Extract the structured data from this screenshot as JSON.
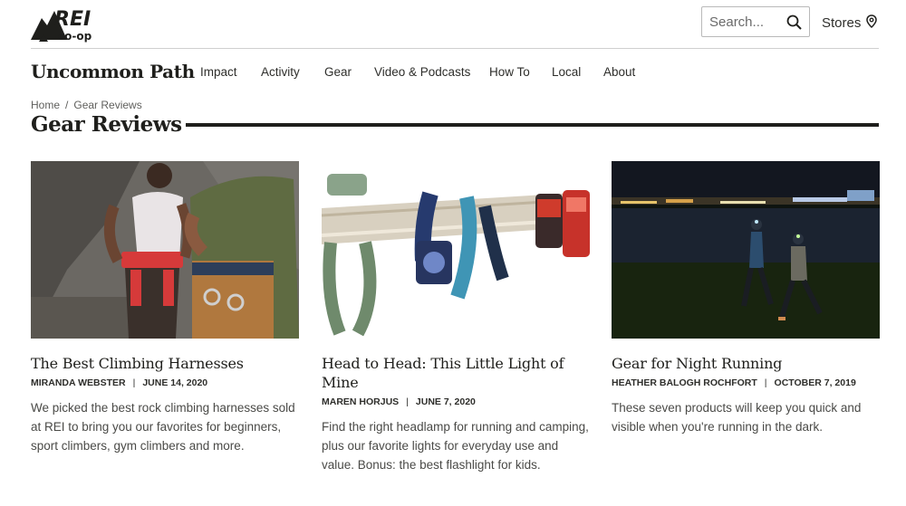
{
  "header": {
    "logo_text_top": "REI",
    "logo_text_bottom": "co-op",
    "search_placeholder": "Search...",
    "stores_label": "Stores"
  },
  "nav": {
    "brand": "Uncommon Path",
    "items": [
      "Impact",
      "Activity",
      "Gear",
      "Video & Podcasts",
      "How To",
      "Local",
      "About"
    ]
  },
  "breadcrumb": {
    "home": "Home",
    "separator": "/",
    "current": "Gear Reviews"
  },
  "page": {
    "title": "Gear Reviews"
  },
  "articles": [
    {
      "title": "The Best Climbing Harnesses",
      "author": "MIRANDA WEBSTER",
      "date": "JUNE 14, 2020",
      "excerpt": "We picked the best rock climbing harnesses sold at REI to bring you our favorites for beginners, sport climbers, gym climbers and more."
    },
    {
      "title": "Head to Head: This Little Light of Mine",
      "author": "MAREN HORJUS",
      "date": "JUNE 7, 2020",
      "excerpt": "Find the right headlamp for running and camping, plus our favorite lights for everyday use and value. Bonus: the best flashlight for kids."
    },
    {
      "title": "Gear for Night Running",
      "author": "HEATHER BALOGH ROCHFORT",
      "date": "OCTOBER 7, 2019",
      "excerpt": "These seven products will keep you quick and visible when you're running in the dark."
    }
  ],
  "meta_separator": "|",
  "icons": {
    "search": "search-icon",
    "stores": "map-pin-icon"
  }
}
